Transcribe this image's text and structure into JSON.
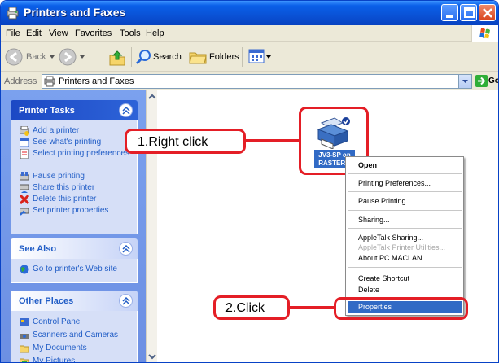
{
  "window": {
    "title": "Printers and Faxes"
  },
  "menubar": {
    "items": [
      "File",
      "Edit",
      "View",
      "Favorites",
      "Tools",
      "Help"
    ]
  },
  "toolbar": {
    "back_label": "Back",
    "search_label": "Search",
    "folders_label": "Folders"
  },
  "address": {
    "label": "Address",
    "value": "Printers and Faxes",
    "go_label": "Go"
  },
  "taskpane": {
    "printer_tasks": {
      "title": "Printer Tasks",
      "items": [
        "Add a printer",
        "See what's printing",
        "Select printing preferences",
        "Pause printing",
        "Share this printer",
        "Delete this printer",
        "Set printer properties"
      ]
    },
    "see_also": {
      "title": "See Also",
      "items": [
        "Go to printer's Web site"
      ]
    },
    "other_places": {
      "title": "Other Places",
      "items": [
        "Control Panel",
        "Scanners and Cameras",
        "My Documents",
        "My Pictures"
      ]
    }
  },
  "printer": {
    "name_line1": "JV3-SP on",
    "name_line2": "RASTER..."
  },
  "callouts": {
    "step1": "1.Right click",
    "step2": "2.Click"
  },
  "context_menu": {
    "items": [
      {
        "label": "Open",
        "bold": true
      },
      {
        "label": "Printing Preferences..."
      },
      {
        "label": "Pause Printing"
      },
      {
        "label": "Sharing..."
      },
      {
        "label": "AppleTalk Sharing..."
      },
      {
        "label": "AppleTalk Printer Utilities...",
        "disabled": true
      },
      {
        "label": "About PC MACLAN"
      },
      {
        "label": "Create Shortcut"
      },
      {
        "label": "Delete"
      },
      {
        "label": "Properties",
        "highlighted": true
      }
    ]
  },
  "colors": {
    "title_bar": "#0a52d6",
    "task_pane": "#7ba1ee",
    "callout_red": "#e41e26",
    "selection": "#316ac5"
  }
}
